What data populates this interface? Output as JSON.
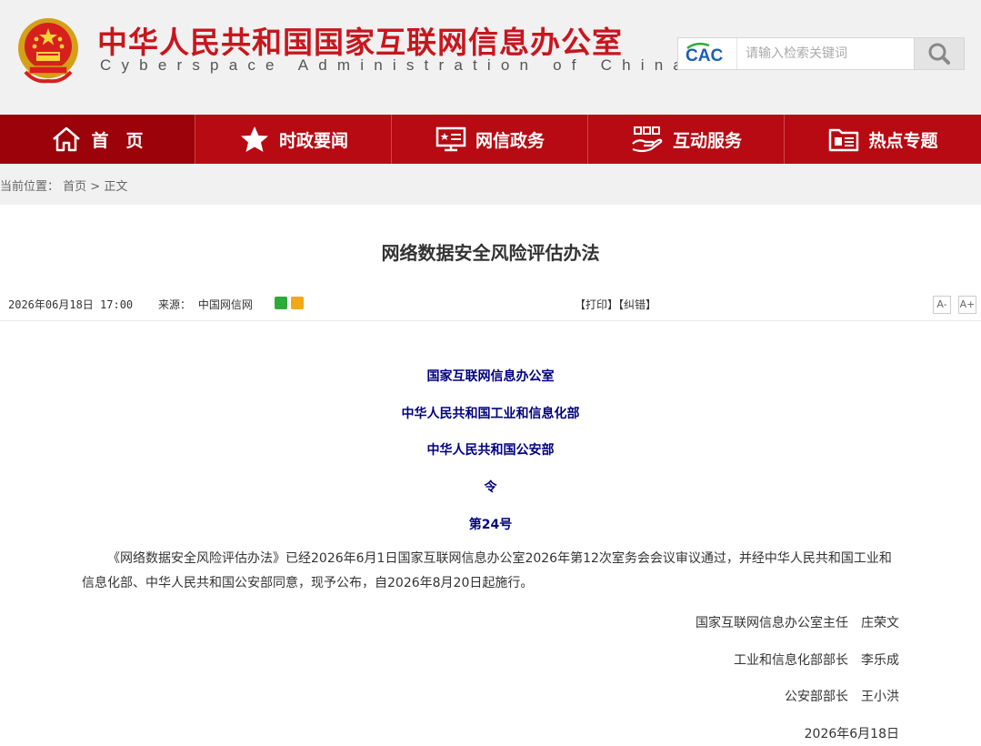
{
  "header": {
    "title": "中华人民共和国国家互联网信息办公室",
    "subtitle": "Cyberspace Administration of China",
    "search_placeholder": "请输入检索关键词",
    "logo_text": "CAC"
  },
  "nav": {
    "items": [
      {
        "label": "首　页",
        "icon": "home-icon"
      },
      {
        "label": "时政要闻",
        "icon": "star-icon"
      },
      {
        "label": "网信政务",
        "icon": "monitor-icon"
      },
      {
        "label": "互动服务",
        "icon": "hand-service-icon"
      },
      {
        "label": "热点专题",
        "icon": "folder-icon"
      }
    ]
  },
  "breadcrumb": {
    "prefix": "当前位置：",
    "home": "首页",
    "sep": " > ",
    "current": "正文"
  },
  "article": {
    "title": "网络数据安全风险评估办法",
    "date": "2026年06月18日 17:00",
    "source_label": "来源：",
    "source": "中国网信网",
    "print": "【打印】",
    "correct": "【纠错】",
    "font_smaller": "A-",
    "font_larger": "A+",
    "issuers": [
      "国家互联网信息办公室",
      "中华人民共和国工业和信息化部",
      "中华人民共和国公安部"
    ],
    "order": "令",
    "number": "第24号",
    "paragraph": "《网络数据安全风险评估办法》已经2026年6月1日国家互联网信息办公室2026年第12次室务会会议审议通过，并经中华人民共和国工业和信息化部、中华人民共和国公安部同意，现予公布，自2026年8月20日起施行。",
    "signatures": [
      "国家互联网信息办公室主任　庄荣文",
      "工业和信息化部部长　李乐成",
      "公安部部长　王小洪"
    ],
    "sign_date": "2026年6月18日"
  },
  "colors": {
    "brand_red": "#c8161d",
    "nav_red": "#b70a12",
    "issuer_blue": "#000080"
  }
}
